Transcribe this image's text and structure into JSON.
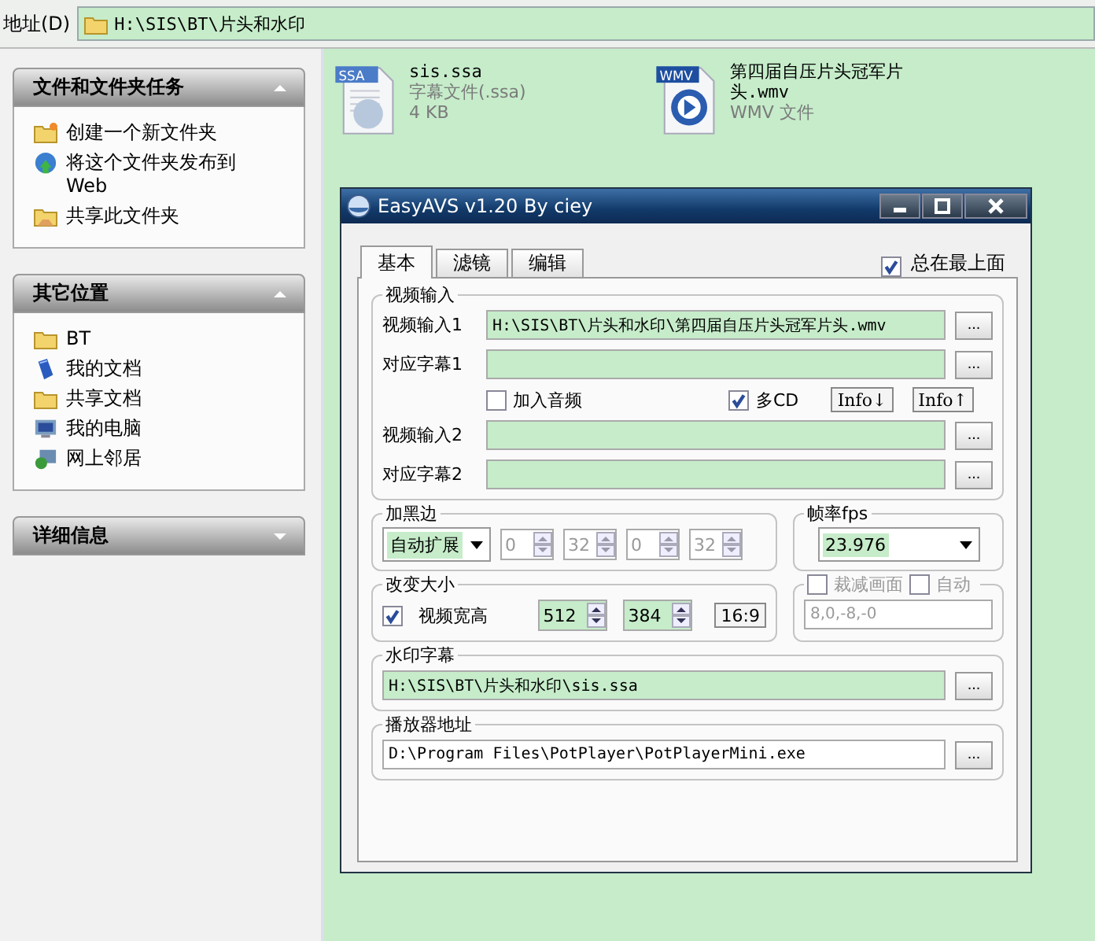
{
  "address_bar": {
    "label": "地址(D)",
    "path": "H:\\SIS\\BT\\片头和水印"
  },
  "sidebar": {
    "panels": [
      {
        "title": "文件和文件夹任务",
        "expanded": true,
        "items": [
          {
            "label": "创建一个新文件夹",
            "kind": "new-folder"
          },
          {
            "label": "将这个文件夹发布到 Web",
            "kind": "globe"
          },
          {
            "label": "共享此文件夹",
            "kind": "shared-folder"
          }
        ]
      },
      {
        "title": "其它位置",
        "expanded": true,
        "items": [
          {
            "label": "BT",
            "kind": "folder"
          },
          {
            "label": "我的文档",
            "kind": "documents"
          },
          {
            "label": "共享文档",
            "kind": "folder"
          },
          {
            "label": "我的电脑",
            "kind": "computer"
          },
          {
            "label": "网上邻居",
            "kind": "network"
          }
        ]
      },
      {
        "title": "详细信息",
        "expanded": false
      }
    ]
  },
  "files": [
    {
      "name": "sis.ssa",
      "type": "字幕文件(.ssa)",
      "size": "4 KB",
      "kind": "ssa",
      "badge": "SSA"
    },
    {
      "name": "第四届自压片头冠军片头.wmv",
      "type": "WMV 文件",
      "kind": "wmv",
      "badge": "WMV"
    }
  ],
  "dialog": {
    "title": "EasyAVS v1.20 By ciey",
    "tabs": [
      {
        "label": "基本",
        "selected": true
      },
      {
        "label": "滤镜",
        "selected": false
      },
      {
        "label": "编辑",
        "selected": false
      }
    ],
    "always_on_top": {
      "label": "总在最上面",
      "checked": true
    },
    "video_input": {
      "title": "视频输入",
      "rows": [
        {
          "label": "视频输入1",
          "value": "H:\\SIS\\BT\\片头和水印\\第四届自压片头冠军片头.wmv",
          "button": "..."
        },
        {
          "label": "对应字幕1",
          "button": "..."
        }
      ],
      "add_audio": {
        "label": "加入音频",
        "checked": false
      },
      "multi_cd": {
        "label": "多CD",
        "checked": true
      },
      "info_buttons": [
        "Info↓",
        "Info↑"
      ],
      "rows2": [
        {
          "label": "视频输入2",
          "button": "..."
        },
        {
          "label": "对应字幕2",
          "button": "..."
        }
      ]
    },
    "black_border": {
      "title": "加黑边",
      "mode": "自动扩展",
      "spinners": [
        {
          "value": "0",
          "disabled": true
        },
        {
          "value": "32",
          "disabled": true
        },
        {
          "value": "0",
          "disabled": true
        },
        {
          "value": "32",
          "disabled": true
        }
      ]
    },
    "frame_rate": {
      "title": "帧率fps",
      "value": "23.976"
    },
    "resize": {
      "title": "改变大小",
      "checkbox": {
        "label": "视频宽高",
        "checked": true
      },
      "width": {
        "value": "512",
        "disabled": false
      },
      "height": {
        "value": "384",
        "disabled": false
      },
      "ratio_button": "16:9"
    },
    "crop": {
      "label": "裁减画面",
      "checked": false,
      "auto_label": "自动",
      "auto_checked": false,
      "value": "8,0,-8,-0",
      "disabled": true
    },
    "watermark": {
      "title": "水印字幕",
      "value": "H:\\SIS\\BT\\片头和水印\\sis.ssa",
      "highlighted": true,
      "button": "..."
    },
    "player": {
      "title": "播放器地址",
      "value": "D:\\Program Files\\PotPlayer\\PotPlayerMini.exe",
      "highlighted": false,
      "button": "..."
    }
  }
}
